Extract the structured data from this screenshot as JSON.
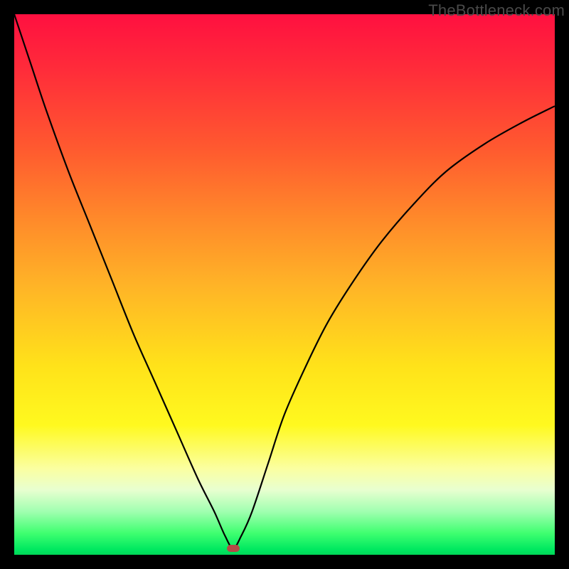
{
  "watermark": "TheBottleneck.com",
  "chart_data": {
    "type": "line",
    "title": "",
    "xlabel": "",
    "ylabel": "",
    "xlim": [
      0,
      100
    ],
    "ylim": [
      0,
      100
    ],
    "grid": false,
    "legend": false,
    "series": [
      {
        "name": "bottleneck-curve",
        "x": [
          0,
          3,
          6,
          10,
          14,
          18,
          22,
          26,
          30,
          34,
          37,
          39,
          40.5,
          42,
          44,
          47,
          50,
          54,
          58,
          63,
          68,
          74,
          80,
          87,
          94,
          100
        ],
        "y": [
          100,
          91,
          82,
          71,
          61,
          51,
          41,
          32,
          23,
          14,
          8,
          3.5,
          1.2,
          3.5,
          8,
          17,
          26,
          35,
          43,
          51,
          58,
          65,
          71,
          76,
          80,
          83
        ]
      }
    ],
    "marker": {
      "x": 40.5,
      "y": 1.2,
      "color": "#b64a46"
    },
    "background_gradient": {
      "top": "#ff1040",
      "mid": "#ffe21a",
      "bottom": "#00d858"
    }
  }
}
